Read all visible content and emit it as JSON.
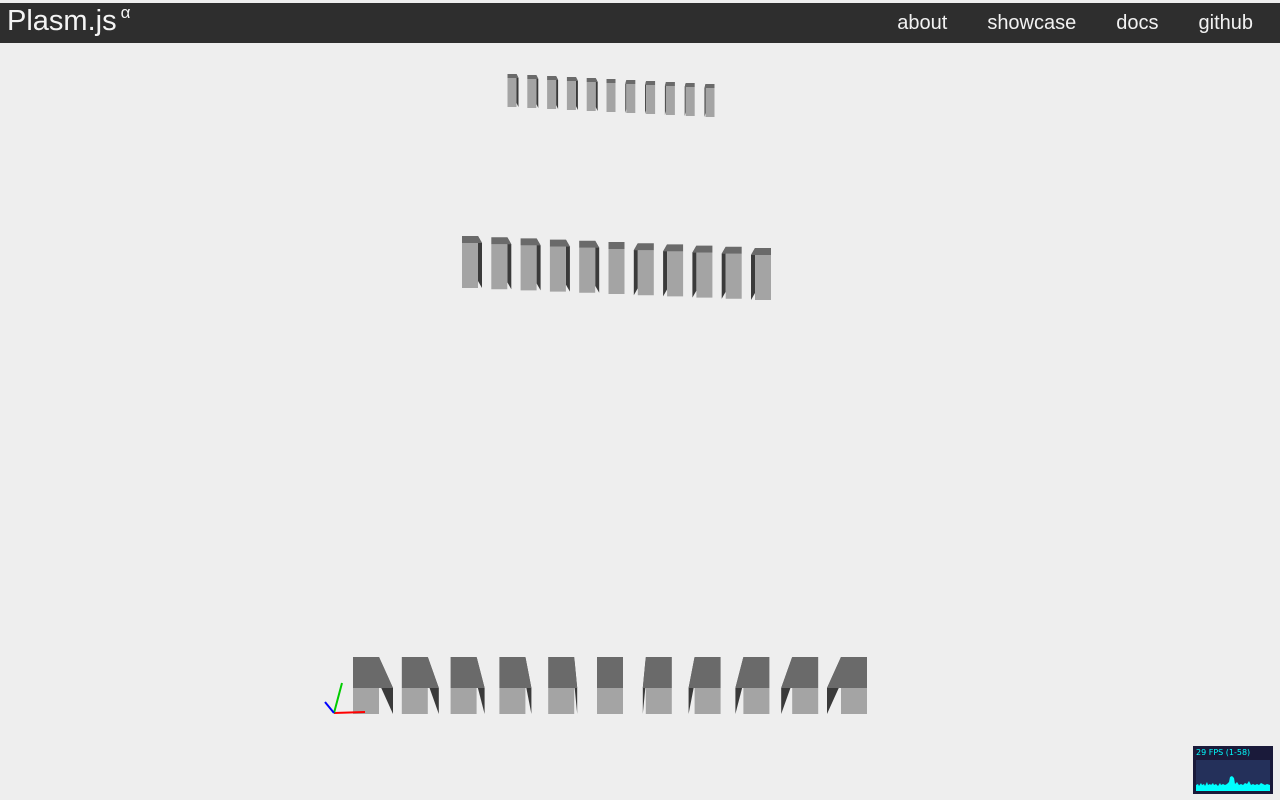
{
  "header": {
    "brand": "Plasm.js",
    "brand_sup": "α",
    "nav": [
      {
        "label": "about"
      },
      {
        "label": "showcase"
      },
      {
        "label": "docs"
      },
      {
        "label": "github"
      }
    ]
  },
  "scene": {
    "rows": [
      {
        "name": "top-row",
        "count": 11
      },
      {
        "name": "middle-row",
        "count": 11
      },
      {
        "name": "bottom-row",
        "count": 11
      }
    ],
    "axes": [
      "x-axis",
      "y-axis",
      "z-axis"
    ],
    "colors": {
      "background": "#eeeeee",
      "face_light": "#a4a4a4",
      "face_mid": "#6a6a6a",
      "face_dark": "#3a3a3a",
      "axis_x": "#ff0000",
      "axis_y": "#00cc00",
      "axis_z": "#0000ff"
    }
  },
  "stats": {
    "fps_text": "29 FPS (1-58)",
    "colors": {
      "text": "#00ffff",
      "bg": "#1a1a3a",
      "graph_bg": "#24305a"
    }
  }
}
